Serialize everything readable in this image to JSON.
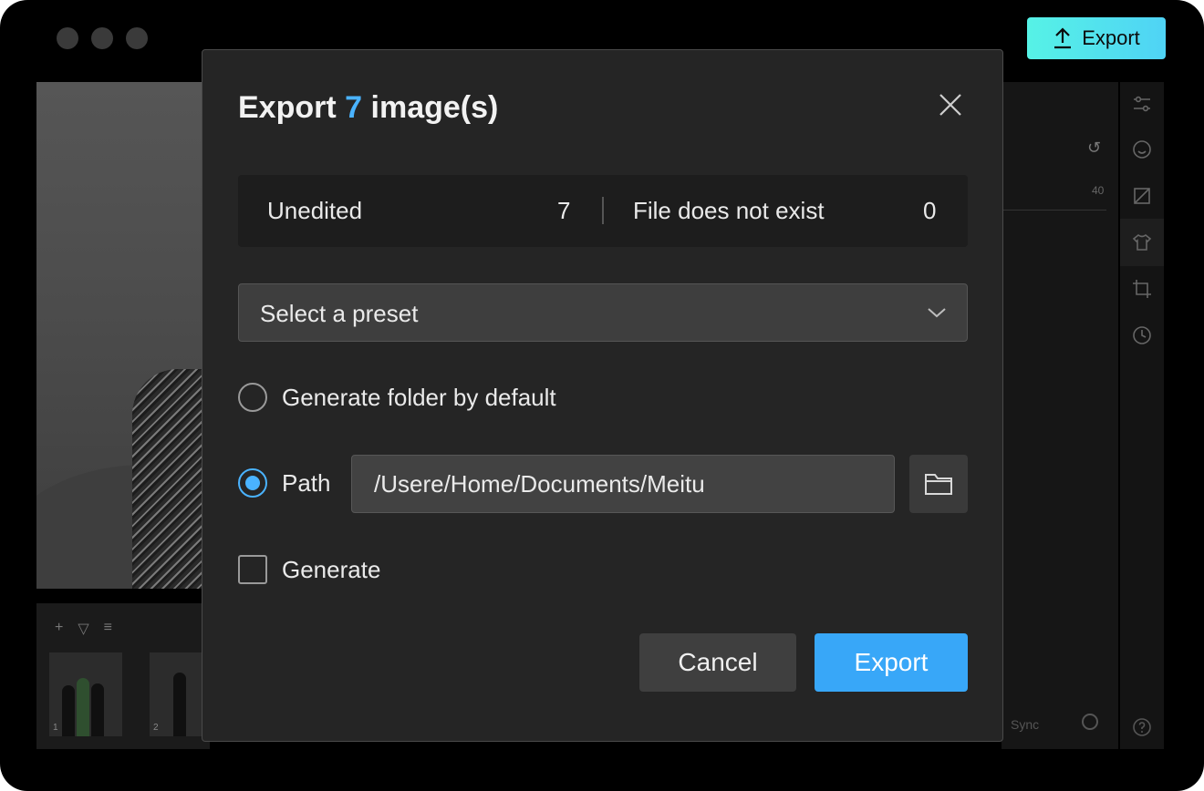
{
  "topbar": {
    "export_label": "Export"
  },
  "dialog": {
    "title_prefix": "Export",
    "title_count": "7",
    "title_suffix": "image(s)",
    "stats": {
      "unedited_label": "Unedited",
      "unedited_value": "7",
      "missing_label": "File does not exist",
      "missing_value": "0"
    },
    "preset": {
      "value": "Select a preset"
    },
    "options": {
      "folder_default_label": "Generate folder by default",
      "folder_default_checked": false,
      "path_label": "Path",
      "path_checked": true,
      "path_value": "/Usere/Home/Documents/Meitu",
      "generate_label": "Generate",
      "generate_checked": false
    },
    "buttons": {
      "cancel": "Cancel",
      "export": "Export"
    }
  },
  "background": {
    "slider_value": "40",
    "sync_label": "Sync",
    "thumbnails": [
      {
        "index": "1"
      },
      {
        "index": "2"
      }
    ]
  },
  "colors": {
    "accent": "#38a7f8",
    "accent_text": "#4ab3ff",
    "top_export_gradient_start": "#56f2e6",
    "top_export_gradient_end": "#4fd3f5",
    "dialog_bg": "#252525"
  }
}
